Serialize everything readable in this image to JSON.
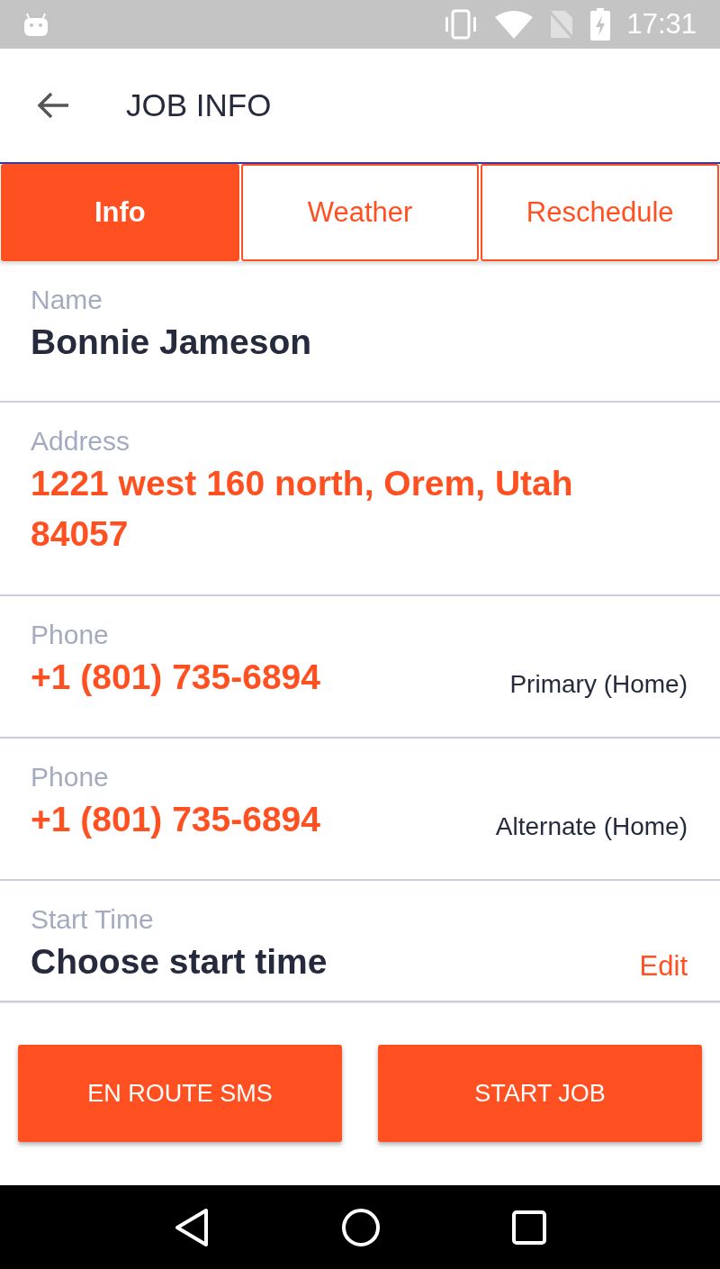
{
  "status_bar": {
    "time": "17:31"
  },
  "app_bar": {
    "title": "JOB INFO"
  },
  "tabs": [
    {
      "label": "Info",
      "selected": true
    },
    {
      "label": "Weather",
      "selected": false
    },
    {
      "label": "Reschedule",
      "selected": false
    }
  ],
  "fields": [
    {
      "label": "Name",
      "value": "Bonnie Jameson",
      "kind": "text"
    },
    {
      "label": "Address",
      "value": "1221 west 160 north, Orem, Utah 84057",
      "kind": "link"
    },
    {
      "label": "Phone",
      "value": "+1 (801) 735-6894",
      "kind": "link",
      "note": "Primary (Home)"
    },
    {
      "label": "Phone",
      "value": "+1 (801) 735-6894",
      "kind": "link",
      "note": "Alternate (Home)"
    },
    {
      "label": "Start Time",
      "value": "Choose start time",
      "kind": "text",
      "action": "Edit"
    }
  ],
  "buttons": [
    "EN ROUTE SMS",
    "START JOB"
  ]
}
